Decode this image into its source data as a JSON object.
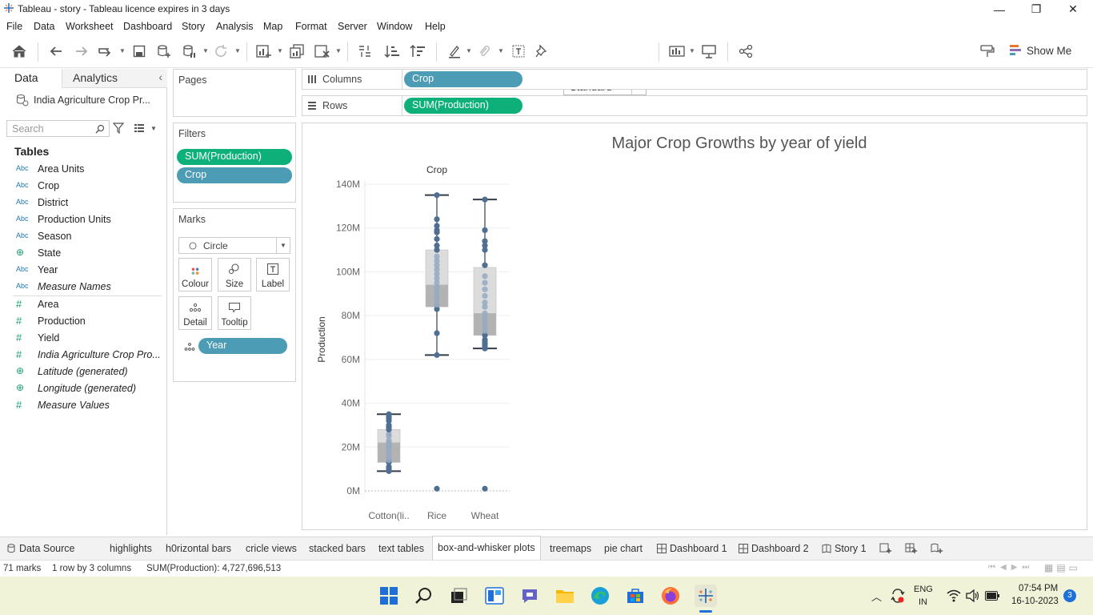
{
  "window": {
    "title": "Tableau - story - Tableau licence expires in 3 days",
    "controls": [
      "—",
      "❐",
      "✕"
    ]
  },
  "menu": [
    "File",
    "Data",
    "Worksheet",
    "Dashboard",
    "Story",
    "Analysis",
    "Map",
    "Format",
    "Server",
    "Window",
    "Help"
  ],
  "toolbar": {
    "fit": "Standard",
    "show_me": "Show Me"
  },
  "datapane": {
    "tab_data": "Data",
    "tab_analytics": "Analytics",
    "datasource": "India Agriculture Crop Pr...",
    "search_placeholder": "Search",
    "tables_heading": "Tables",
    "dimensions": [
      {
        "type": "Abc",
        "name": "Area Units",
        "italic": false
      },
      {
        "type": "Abc",
        "name": "Crop",
        "italic": false
      },
      {
        "type": "Abc",
        "name": "District",
        "italic": false
      },
      {
        "type": "Abc",
        "name": "Production Units",
        "italic": false
      },
      {
        "type": "Abc",
        "name": "Season",
        "italic": false
      },
      {
        "type": "globe",
        "name": "State",
        "italic": false
      },
      {
        "type": "Abc",
        "name": "Year",
        "italic": false
      },
      {
        "type": "Abc",
        "name": "Measure Names",
        "italic": true
      }
    ],
    "measures": [
      {
        "type": "#",
        "name": "Area",
        "italic": false
      },
      {
        "type": "#",
        "name": "Production",
        "italic": false
      },
      {
        "type": "#",
        "name": "Yield",
        "italic": false
      },
      {
        "type": "#",
        "name": "India Agriculture Crop Pro...",
        "italic": true
      },
      {
        "type": "globe",
        "name": "Latitude (generated)",
        "italic": true
      },
      {
        "type": "globe",
        "name": "Longitude (generated)",
        "italic": true
      },
      {
        "type": "#",
        "name": "Measure Values",
        "italic": true
      }
    ]
  },
  "cards": {
    "pages_title": "Pages",
    "filters_title": "Filters",
    "filters": [
      "SUM(Production)",
      "Crop"
    ],
    "marks_title": "Marks",
    "mark_type": "Circle",
    "mark_buttons": [
      "Colour",
      "Size",
      "Label",
      "Detail",
      "Tooltip"
    ],
    "detail_pill": "Year"
  },
  "shelves": {
    "columns_label": "Columns",
    "columns_pill": "Crop",
    "rows_label": "Rows",
    "rows_pill": "SUM(Production)"
  },
  "chart_data": {
    "type": "box-and-whisker",
    "title": "Major Crop Growths by year of yield",
    "header": "Crop",
    "ylabel": "Production",
    "ylim": [
      0,
      140000000
    ],
    "yticks": [
      "0M",
      "20M",
      "40M",
      "60M",
      "80M",
      "100M",
      "120M",
      "140M"
    ],
    "ytick_values": [
      0,
      20000000,
      40000000,
      60000000,
      80000000,
      100000000,
      120000000,
      140000000
    ],
    "categories": [
      "Cotton(li..",
      "Rice",
      "Wheat"
    ],
    "boxes": [
      {
        "category": "Cotton(li..",
        "min": 9000000,
        "q1": 13000000,
        "median": 22000000,
        "q3": 28000000,
        "max": 35000000
      },
      {
        "category": "Rice",
        "min": 62000000,
        "q1": 84000000,
        "median": 94000000,
        "q3": 110000000,
        "max": 135000000
      },
      {
        "category": "Wheat",
        "min": 65000000,
        "q1": 71000000,
        "median": 81000000,
        "q3": 102000000,
        "max": 133000000
      }
    ],
    "points": [
      {
        "category": "Cotton(li..",
        "values": [
          9000000,
          10000000,
          11000000,
          13000000,
          14000000,
          15000000,
          17000000,
          18000000,
          20000000,
          21000000,
          22000000,
          23000000,
          25000000,
          26000000,
          28000000,
          29000000,
          30000000,
          32000000,
          33000000,
          34000000,
          35000000
        ]
      },
      {
        "category": "Rice",
        "values": [
          1000000,
          62000000,
          72000000,
          83000000,
          85000000,
          87000000,
          89000000,
          91000000,
          93000000,
          95000000,
          97000000,
          99000000,
          101000000,
          103000000,
          105000000,
          107000000,
          110000000,
          112000000,
          115000000,
          118000000,
          119000000,
          121000000,
          124000000,
          135000000
        ]
      },
      {
        "category": "Wheat",
        "values": [
          1000000,
          65000000,
          66000000,
          67000000,
          68000000,
          69000000,
          71000000,
          73000000,
          75000000,
          77000000,
          79000000,
          81000000,
          84000000,
          86000000,
          89000000,
          92000000,
          95000000,
          98000000,
          103000000,
          110000000,
          112000000,
          114000000,
          119000000,
          133000000
        ]
      }
    ]
  },
  "sheettabs": [
    "Data Source",
    "highlights",
    "h0rizontal bars",
    "cricle views",
    "stacked bars",
    "text tables",
    "box-and-whisker plots",
    "treemaps",
    "pie chart",
    "Dashboard 1",
    "Dashboard 2",
    "Story 1"
  ],
  "active_tab": "box-and-whisker plots",
  "status": {
    "marks": "71 marks",
    "dims": "1 row  by  3 columns",
    "sum": "SUM(Production): 4,727,696,513"
  },
  "taskbar": {
    "lang_top": "ENG",
    "lang_bottom": "IN",
    "time": "07:54 PM",
    "date": "16-10-2023",
    "notifications": "3"
  },
  "colors": {
    "accent_green": "#0cb078",
    "accent_blue": "#4d9cb6",
    "mark": "#4e6f92",
    "taskbar": "#f1f3d9"
  }
}
